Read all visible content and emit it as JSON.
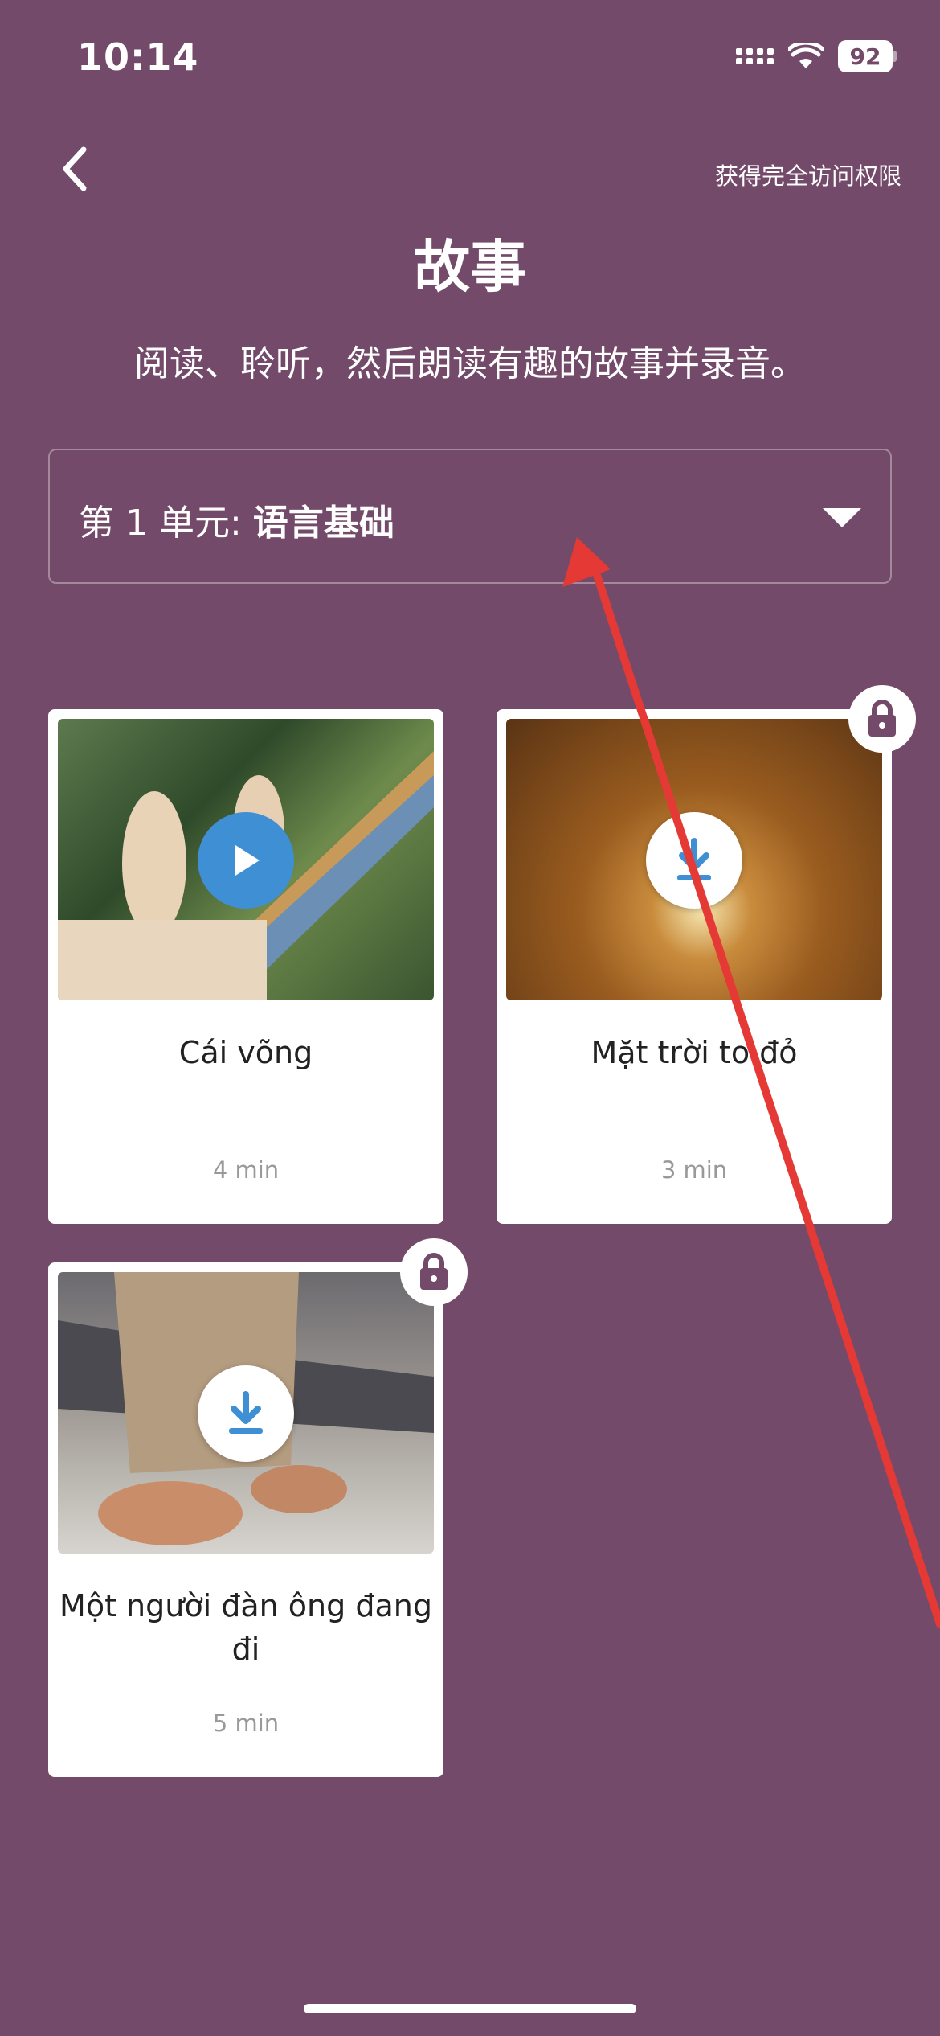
{
  "status_bar": {
    "time": "10:14",
    "battery": "92"
  },
  "header": {
    "back_icon": "chevron-left-icon",
    "full_access_label": "获得完全访问权限",
    "title": "故事",
    "subtitle": "阅读、聆听，然后朗读有趣的故事并录音。"
  },
  "unit_selector": {
    "prefix": "第 1 单元:",
    "name": "语言基础"
  },
  "stories": [
    {
      "title": "Cái võng",
      "duration": "4 min",
      "locked": false,
      "action_icon": "play-icon"
    },
    {
      "title": "Mặt trời to đỏ",
      "duration": "3 min",
      "locked": true,
      "action_icon": "download-icon"
    },
    {
      "title": "Một người đàn ông đang đi",
      "duration": "5 min",
      "locked": true,
      "action_icon": "download-icon"
    }
  ],
  "colors": {
    "background": "#734a69",
    "accent": "#3f8fd4",
    "annotation": "#e53935"
  }
}
